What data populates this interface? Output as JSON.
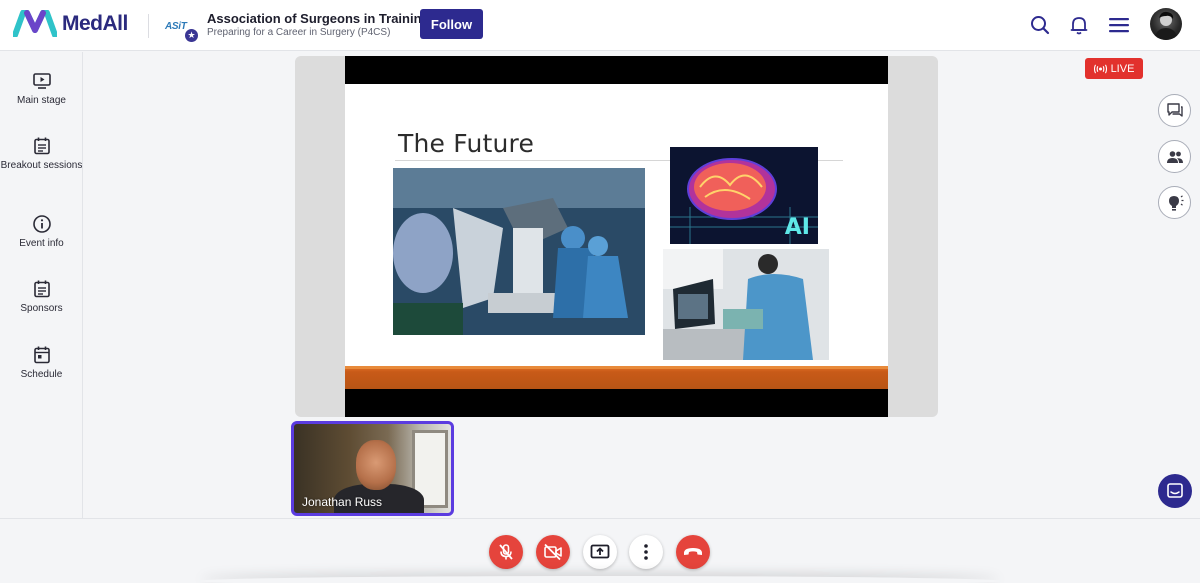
{
  "header": {
    "brand": "MedAll",
    "org_logo_text": "ASiT",
    "org_title": "Association of Surgeons in Training",
    "org_subtitle": "Preparing for a Career in Surgery (P4CS)",
    "follow_label": "Follow",
    "icons": [
      "search-icon",
      "bell-icon",
      "menu-icon",
      "avatar"
    ]
  },
  "sidebar": {
    "items": [
      {
        "label": "Main stage",
        "icon": "play-screen-icon"
      },
      {
        "label": "Breakout sessions",
        "icon": "calendar-list-icon"
      },
      {
        "label": "Event info",
        "icon": "info-icon"
      },
      {
        "label": "Sponsors",
        "icon": "calendar-list-icon"
      },
      {
        "label": "Schedule",
        "icon": "calendar-icon"
      }
    ]
  },
  "stage": {
    "slide_title": "The Future",
    "ai_label": "AI",
    "live_label": "LIVE"
  },
  "participant": {
    "name": "Jonathan Russ"
  },
  "right_panel": [
    "chat-icon",
    "people-icon",
    "lightbulb-icon"
  ],
  "controls": [
    "mic-off-icon",
    "camera-off-icon",
    "share-screen-icon",
    "more-icon",
    "hang-up-icon"
  ],
  "colors": {
    "brand": "#2d2a8f",
    "live": "#e2312d",
    "control_red": "#e5443c",
    "tile_border": "#5b3ce0",
    "slide_accent": "#c85a18"
  }
}
